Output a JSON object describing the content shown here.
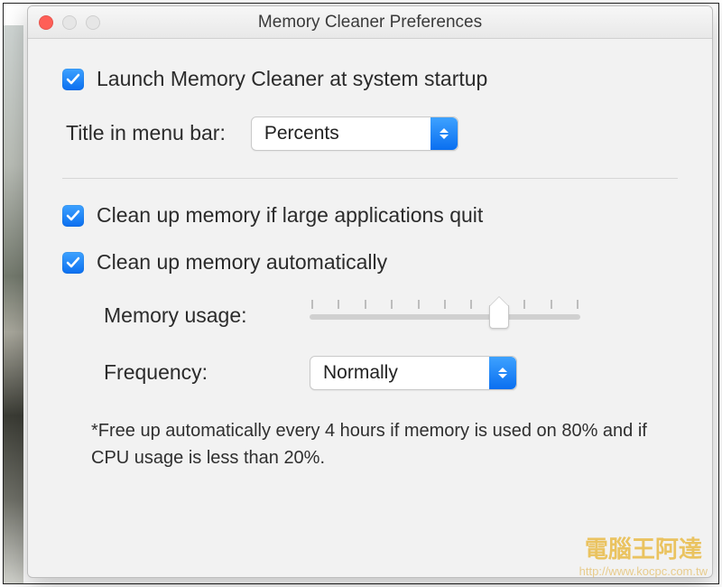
{
  "window": {
    "title": "Memory Cleaner Preferences"
  },
  "prefs": {
    "launch_at_startup": {
      "label": "Launch Memory Cleaner at system startup",
      "checked": true
    },
    "title_in_menu_bar": {
      "label": "Title in menu bar:",
      "value": "Percents"
    },
    "clean_on_quit": {
      "label": "Clean up memory if large applications quit",
      "checked": true
    },
    "clean_auto": {
      "label": "Clean up memory automatically",
      "checked": true
    },
    "memory_usage": {
      "label": "Memory usage:",
      "value_pct": 70,
      "ticks": 11
    },
    "frequency": {
      "label": "Frequency:",
      "value": "Normally"
    },
    "note": "*Free up automatically every 4 hours if memory is used on 80% and if CPU usage is less than 20%."
  },
  "watermark": {
    "main": "電腦王阿達",
    "sub": "http://www.kocpc.com.tw"
  }
}
